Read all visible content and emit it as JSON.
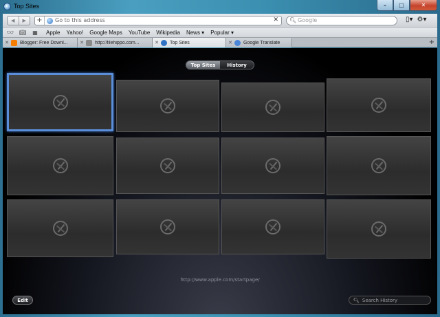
{
  "window": {
    "title": "Top Sites"
  },
  "toolbar": {
    "back_icon": "back-arrow-icon",
    "forward_icon": "forward-arrow-icon",
    "add_bookmark": "+",
    "address_placeholder": "Go to this address",
    "search_placeholder": "Google",
    "page_menu_icon": "page-icon",
    "settings_icon": "gear-icon"
  },
  "bookmarks": {
    "items": [
      "Apple",
      "Yahoo!",
      "Google Maps",
      "YouTube",
      "Wikipedia",
      "News ▾",
      "Popular ▾"
    ]
  },
  "tabs": [
    {
      "label": "Blogger: Free Downl...",
      "favicon_color": "#f57d00"
    },
    {
      "label": "http://filehippo.com...",
      "favicon_color": "#8a8a8a"
    },
    {
      "label": "Top Sites",
      "favicon_color": "#2f72c4"
    },
    {
      "label": "Google Translate",
      "favicon_color": "#4a86d8"
    }
  ],
  "new_tab": "+",
  "content": {
    "segmented": {
      "top_sites": "Top Sites",
      "history": "History"
    },
    "page_url": "http://www.apple.com/startpage/",
    "edit_label": "Edit",
    "history_search_placeholder": "Search History"
  }
}
